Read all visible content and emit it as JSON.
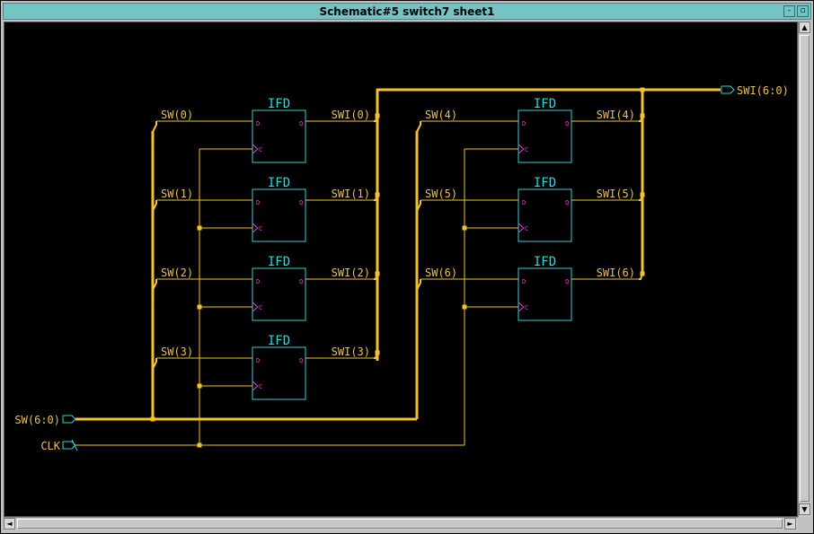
{
  "window": {
    "title": "Schematic#5 switch7 sheet1",
    "minimize_glyph": "-",
    "maximize_glyph": "▫"
  },
  "scroll": {
    "up_glyph": "▲",
    "down_glyph": "▼",
    "left_glyph": "◄",
    "right_glyph": "►"
  },
  "colors": {
    "background": "#000000",
    "wire": "#f2c230",
    "bus": "#f2c230",
    "component": "#3fd0d0",
    "pin": "#e040e0",
    "label": "#e8c050"
  },
  "schematic": {
    "component_type": "IFD",
    "pin_d": "D",
    "pin_q": "Q",
    "pin_c": "C",
    "ports": {
      "input_bus": "SW(6:0)",
      "clock": "CLK",
      "output_bus": "SWI(6:0)"
    },
    "inputs": [
      "SW(0)",
      "SW(1)",
      "SW(2)",
      "SW(3)",
      "SW(4)",
      "SW(5)",
      "SW(6)"
    ],
    "outputs": [
      "SWI(0)",
      "SWI(1)",
      "SWI(2)",
      "SWI(3)",
      "SWI(4)",
      "SWI(5)",
      "SWI(6)"
    ]
  }
}
